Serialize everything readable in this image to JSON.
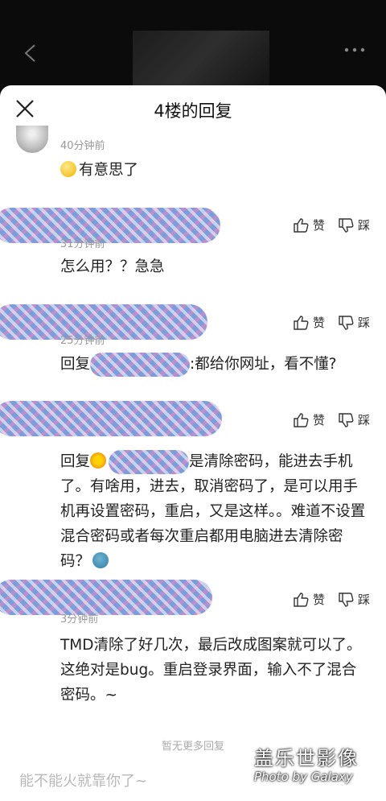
{
  "sheet": {
    "title": "4楼的回复",
    "no_more_text": "暂无更多回复",
    "reply_placeholder": "能不能火就靠你了~"
  },
  "actions": {
    "like_label": "赞",
    "dislike_label": "踩"
  },
  "comments": [
    {
      "time": "40分钟前",
      "text": "有意思了"
    },
    {
      "time": "31分钟前",
      "text": "怎么用？？急急"
    },
    {
      "time": "25分钟前",
      "prefix": "回复",
      "suffix": ":都给你网址，看不懂?"
    },
    {
      "prefix": "回复",
      "suffix": "是清除密码，能进去手机了。有啥用，进去，取消密码了，是可以用手机再设置密码，重启，又是这样。。难道不设置混合密码或者每次重启都用电脑进去清除密码？"
    },
    {
      "time": "3分钟前",
      "text": "TMD清除了好几次，最后改成图案就可以了。这绝对是bug。重启登录界面，输入不了混合密码。~"
    }
  ],
  "watermark": {
    "main": "盖乐世影像",
    "sub": "Photo by Galaxy"
  },
  "icons": {
    "back": "chevron-left-icon",
    "more": "more-dots-icon",
    "close": "close-icon",
    "like": "thumbs-up-icon",
    "dislike": "thumbs-down-icon"
  }
}
